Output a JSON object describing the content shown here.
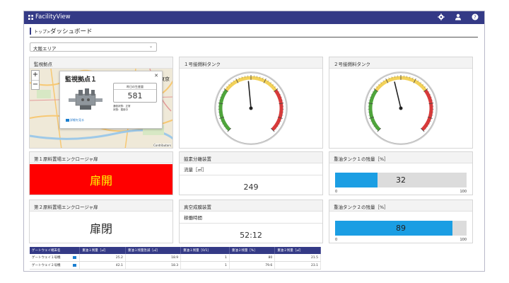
{
  "app": {
    "title": "FacilityView"
  },
  "breadcrumb": {
    "home": "トップ",
    "sep": "> ",
    "title": "ダッシュボード"
  },
  "area_select": {
    "value": "大阪エリア"
  },
  "panels": {
    "map": {
      "title": "監視拠点",
      "map_place": "東京",
      "popup_title": "監視拠点１",
      "popup_value_label": "昨日の生産量",
      "popup_value": "581",
      "popup_detail": [
        "通信状態：正常",
        "状態：運用中"
      ],
      "popup_link": "詳細を見る",
      "zoom_in": "+",
      "zoom_out": "−",
      "credit": "Contributors"
    },
    "tank1": {
      "title": "１号接燃料タンク",
      "gauge": {
        "min": 0,
        "max": 100,
        "value": 48
      }
    },
    "tank2": {
      "title": "２号接燃料タンク",
      "gauge": {
        "min": 0,
        "max": 100,
        "value": 45
      }
    },
    "enc1": {
      "title": "第１原料置場エンクロージャ扉",
      "status": "扉開",
      "status_bg": "#ff0000",
      "status_fg": "#ffff00"
    },
    "enc2": {
      "title": "第２原料置場エンクロージャ扉",
      "status": "扉閉",
      "status_bg": "#ffffff",
      "status_fg": "#222222"
    },
    "separator": {
      "title": "鼓素分離装置",
      "label": "流量［㎥］",
      "value": "249"
    },
    "vacuum": {
      "title": "真空成膜装置",
      "label": "稼働時間",
      "value": "52:12"
    },
    "oil1": {
      "title": "重油タンク１の残量［%］",
      "value": 32,
      "min": "0",
      "max": "100",
      "bar_color": "#1b9ee3"
    },
    "oil2": {
      "title": "重油タンク２の残量［%］",
      "value": 89,
      "min": "0",
      "max": "100",
      "bar_color": "#1b9ee3"
    }
  },
  "table": {
    "columns": [
      "ゲートウェイ端末名",
      "重油１残量［㎥］",
      "重油１残量急減［㎥］",
      "重油１残量［0/1］",
      "重油２残量［%］",
      "重油２残量［㎥］"
    ],
    "rows": [
      {
        "name": "ゲートウェイ１号機",
        "c1": "25.2",
        "c2": "18.9",
        "c3": "1",
        "c4": "80",
        "c5": "21.5"
      },
      {
        "name": "ゲートウェイ２号機",
        "c1": "42.1",
        "c2": "18.3",
        "c3": "1",
        "c4": "79.6",
        "c5": "23.1"
      }
    ]
  },
  "colors": {
    "header": "#343a86",
    "accent": "#1b9ee3",
    "alarm": "#ff0000"
  },
  "icons": [
    "grid-icon",
    "gear-icon",
    "user-icon",
    "help-icon",
    "chevron-down-icon",
    "close-icon",
    "link-icon"
  ]
}
